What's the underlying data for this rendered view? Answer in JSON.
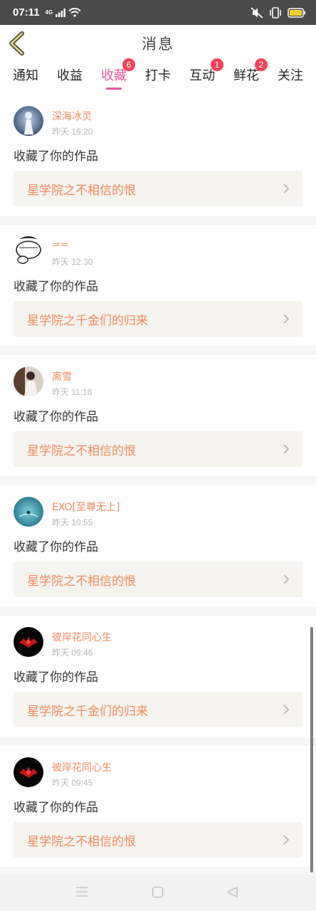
{
  "status_bar": {
    "time": "07:11",
    "signal_label": "4G"
  },
  "header": {
    "title": "消息"
  },
  "tabs": [
    {
      "label": "通知",
      "badge": ""
    },
    {
      "label": "收益",
      "badge": ""
    },
    {
      "label": "收藏",
      "badge": "6"
    },
    {
      "label": "打卡",
      "badge": ""
    },
    {
      "label": "互动",
      "badge": "1"
    },
    {
      "label": "鲜花",
      "badge": "2"
    },
    {
      "label": "关注",
      "badge": ""
    }
  ],
  "active_tab": "收藏",
  "items": [
    {
      "username": "深海冰灵",
      "time": "昨天 16:20",
      "action": "收藏了你的作品",
      "work_title": "星学院之不相信的恨"
    },
    {
      "username": "==",
      "time": "昨天 12:30",
      "action": "收藏了你的作品",
      "work_title": "星学院之千金们的归来"
    },
    {
      "username": "离雪",
      "time": "昨天 11:18",
      "action": "收藏了你的作品",
      "work_title": "星学院之不相信的恨"
    },
    {
      "username": "EXO[至尊无上]",
      "time": "昨天 10:55",
      "action": "收藏了你的作品",
      "work_title": "星学院之不相信的恨"
    },
    {
      "username": "彼岸花同心生",
      "time": "昨天 09:46",
      "action": "收藏了你的作品",
      "work_title": "星学院之千金们的归来"
    },
    {
      "username": "彼岸花同心生",
      "time": "昨天 09:45",
      "action": "收藏了你的作品",
      "work_title": "星学院之不相信的恨"
    }
  ],
  "colors": {
    "accent": "#e8559a",
    "username": "#f08a5d",
    "badge": "#f44058",
    "link_bg": "#f5f4ee"
  }
}
